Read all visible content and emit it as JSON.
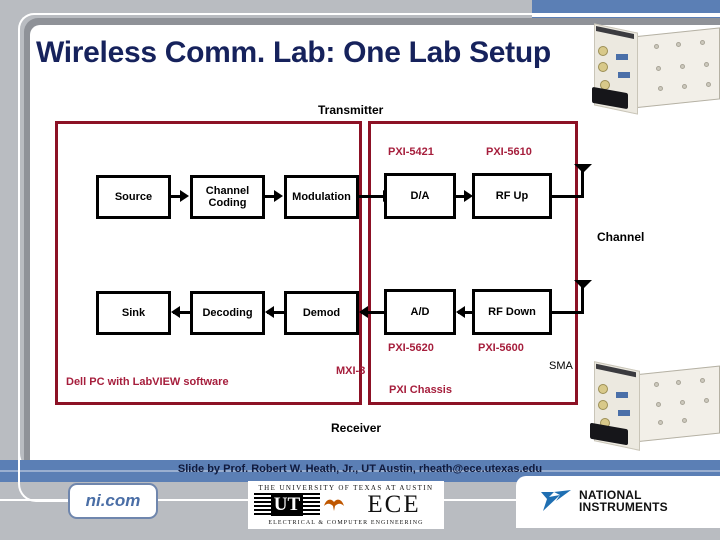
{
  "slide": {
    "title": "Wireless Comm. Lab: One Lab Setup",
    "title_color": "#16225c",
    "accent_red": "#8c1125",
    "label_red": "#a61e3c",
    "bar_blue": "#5b7fb5"
  },
  "diagram": {
    "transmitter_label": "Transmitter",
    "receiver_label": "Receiver",
    "channel_label": "Channel",
    "sma_label": "SMA",
    "mxi_label": "MXI-3",
    "enclosures": [
      {
        "name": "pc",
        "caption": "Dell PC with LabVIEW software"
      },
      {
        "name": "chassis",
        "caption": "PXI Chassis"
      }
    ],
    "tx_blocks": [
      {
        "label": "Source",
        "part": ""
      },
      {
        "label": "Channel Coding",
        "part": ""
      },
      {
        "label": "Modulation",
        "part": ""
      },
      {
        "label": "D/A",
        "part": "PXI-5421"
      },
      {
        "label": "RF Up",
        "part": "PXI-5610"
      }
    ],
    "rx_blocks": [
      {
        "label": "Sink",
        "part": ""
      },
      {
        "label": "Decoding",
        "part": ""
      },
      {
        "label": "Demod",
        "part": ""
      },
      {
        "label": "A/D",
        "part": "PXI-5620"
      },
      {
        "label": "RF Down",
        "part": "PXI-5600"
      }
    ]
  },
  "footer": {
    "credit": "Slide by Prof. Robert W. Heath, Jr., UT Austin, rheath@ece.utexas.edu",
    "ni_logo_text": "ni.com",
    "ut_logo": {
      "top_rule": "THE UNIVERSITY OF TEXAS AT AUSTIN",
      "monogram": "UT",
      "dept": "ECE",
      "bottom_rule": "ELECTRICAL & COMPUTER ENGINEERING"
    },
    "nati_logo": {
      "line1": "NATIONAL",
      "line2": "INSTRUMENTS",
      "tm": "™"
    }
  }
}
